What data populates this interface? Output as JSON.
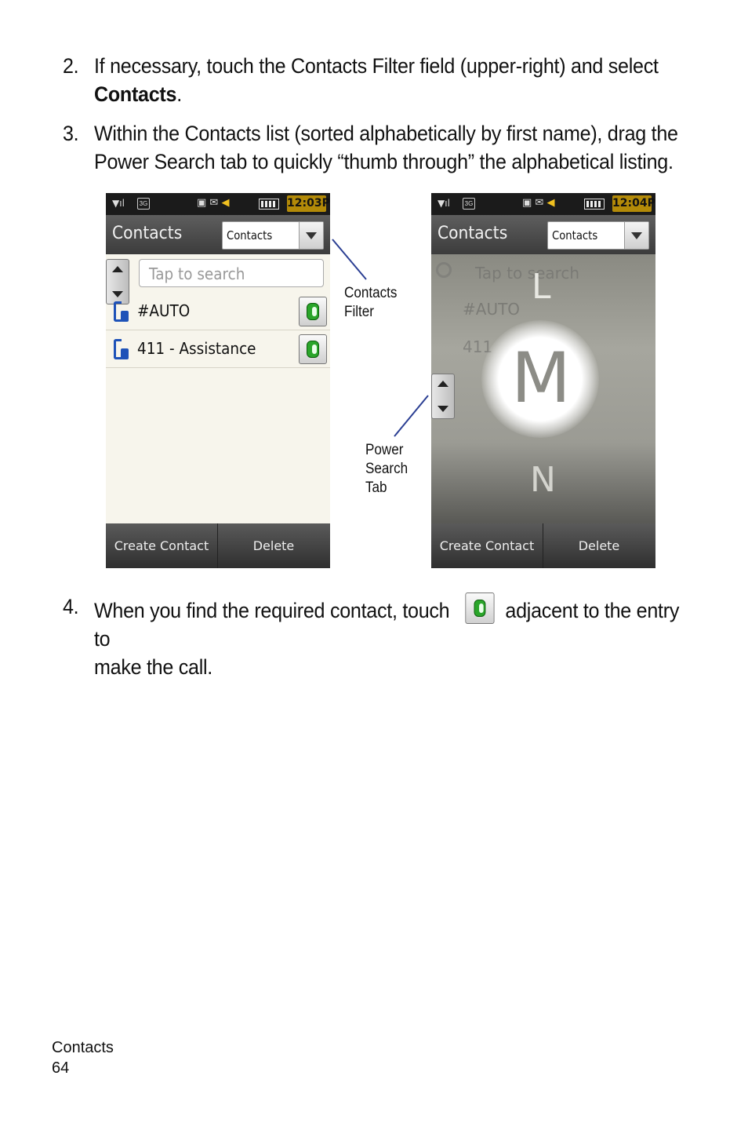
{
  "steps": [
    {
      "num": "2.",
      "line1": "If necessary, touch the Contacts Filter field (upper-right) and select",
      "bold": "Contacts",
      "after_bold": "."
    },
    {
      "num": "3.",
      "line1": "Within the Contacts list (sorted alphabetically by first name), drag the",
      "line2": "Power Search tab to quickly “thumb through” the alphabetical listing."
    },
    {
      "num": "4.",
      "before_icon": "When you find the required contact, touch",
      "after_icon": "adjacent to the entry to",
      "line2": "make the call."
    }
  ],
  "phone_left": {
    "time": "12:03P",
    "title": "Contacts",
    "filter_value": "Contacts",
    "search_placeholder": "Tap to search",
    "contacts": [
      "#AUTO",
      "411 - Assistance"
    ],
    "buttons": [
      "Create Contact",
      "Delete"
    ]
  },
  "phone_right": {
    "time": "12:04P",
    "title": "Contacts",
    "filter_value": "Contacts",
    "search_placeholder": "Tap to search",
    "ghost_contacts": [
      "#AUTO",
      "411"
    ],
    "letters": [
      "L",
      "M",
      "N"
    ],
    "buttons": [
      "Create Contact",
      "Delete"
    ]
  },
  "callouts": {
    "contacts_filter": [
      "Contacts",
      "Filter"
    ],
    "power_search_tab": [
      "Power",
      "Search",
      "Tab"
    ]
  },
  "footer": {
    "section": "Contacts",
    "page": "64"
  },
  "colors": {
    "call_green": "#2aa52a",
    "clock_bg": "#b38a08",
    "contact_icon_blue": "#1e52b8"
  }
}
